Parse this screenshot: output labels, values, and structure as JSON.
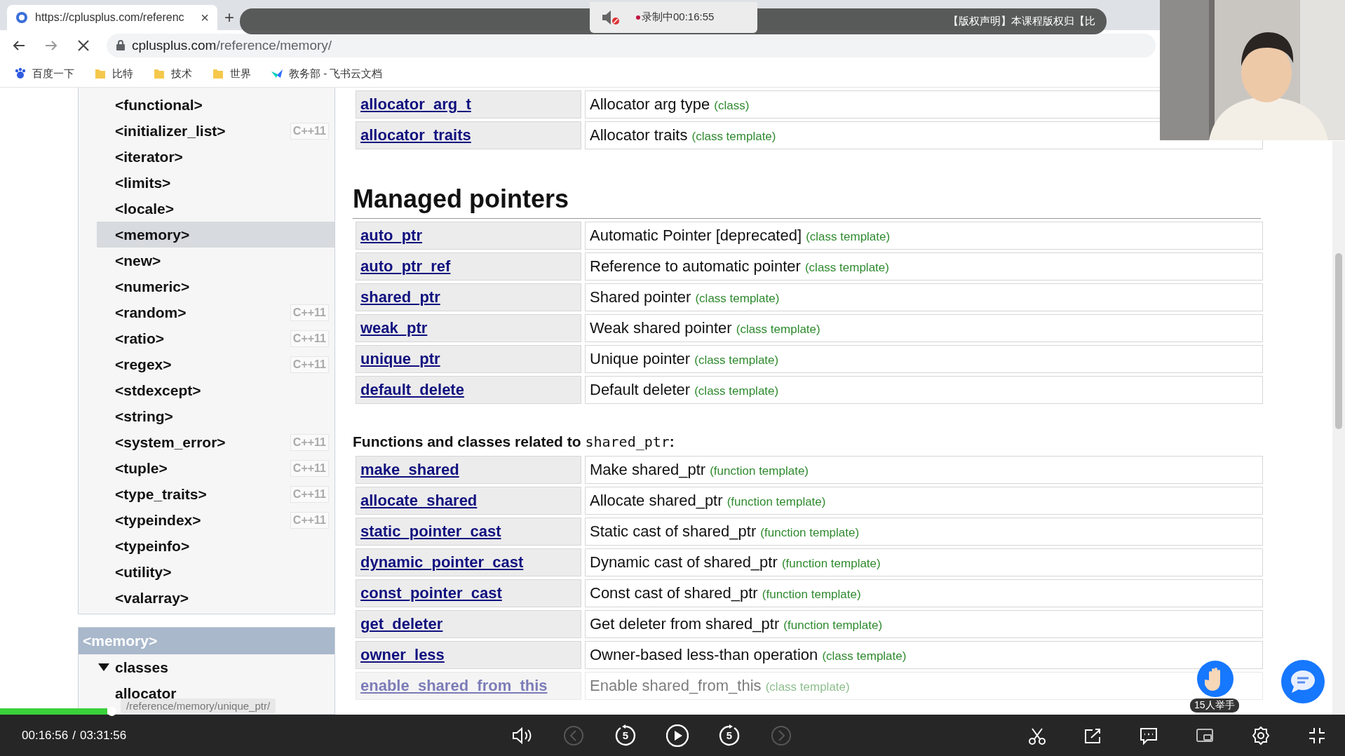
{
  "browser": {
    "tab": {
      "title": "https://cplusplus.com/referenc",
      "close": "×",
      "selected": true
    },
    "new_tab": "+",
    "loading": true,
    "address": {
      "host": "cplusplus.com",
      "path": "/reference/memory/"
    },
    "bookmarks": [
      {
        "label": "百度一下",
        "kind": "site"
      },
      {
        "label": "比特",
        "kind": "folder"
      },
      {
        "label": "技术",
        "kind": "folder"
      },
      {
        "label": "世界",
        "kind": "folder"
      },
      {
        "label": "教务部 - 飞书云文档",
        "kind": "app"
      }
    ]
  },
  "recording_bar": {
    "muted": true,
    "status": "录制中00:16:55",
    "notice": "【版权声明】本课程版权归【比"
  },
  "sidebar": {
    "headers": [
      {
        "label": "<functional>",
        "selected": false
      },
      {
        "label": "<initializer_list>",
        "selected": false,
        "badge": "C++11"
      },
      {
        "label": "<iterator>",
        "selected": false
      },
      {
        "label": "<limits>",
        "selected": false
      },
      {
        "label": "<locale>",
        "selected": false
      },
      {
        "label": "<memory>",
        "selected": true
      },
      {
        "label": "<new>",
        "selected": false
      },
      {
        "label": "<numeric>",
        "selected": false
      },
      {
        "label": "<random>",
        "selected": false,
        "badge": "C++11"
      },
      {
        "label": "<ratio>",
        "selected": false,
        "badge": "C++11"
      },
      {
        "label": "<regex>",
        "selected": false,
        "badge": "C++11"
      },
      {
        "label": "<stdexcept>",
        "selected": false
      },
      {
        "label": "<string>",
        "selected": false
      },
      {
        "label": "<system_error>",
        "selected": false,
        "badge": "C++11"
      },
      {
        "label": "<tuple>",
        "selected": false,
        "badge": "C++11"
      },
      {
        "label": "<type_traits>",
        "selected": false,
        "badge": "C++11"
      },
      {
        "label": "<typeindex>",
        "selected": false,
        "badge": "C++11"
      },
      {
        "label": "<typeinfo>",
        "selected": false
      },
      {
        "label": "<utility>",
        "selected": false
      },
      {
        "label": "<valarray>",
        "selected": false
      }
    ],
    "section": {
      "title": "<memory>",
      "groups": [
        {
          "label": "classes",
          "expanded": true,
          "children": [
            {
              "label": "allocator"
            }
          ]
        }
      ]
    }
  },
  "main": {
    "top_rows": [
      {
        "name": "allocator_arg_t",
        "description": "Allocator arg type",
        "category": "(class)"
      },
      {
        "name": "allocator_traits",
        "description": "Allocator traits",
        "category": "(class template)"
      }
    ],
    "sections": [
      {
        "kind": "heading",
        "title": "Managed pointers",
        "rows": [
          {
            "name": "auto_ptr",
            "description": "Automatic Pointer [deprecated]",
            "category": "(class template)"
          },
          {
            "name": "auto_ptr_ref",
            "description": "Reference to automatic pointer",
            "category": "(class template)"
          },
          {
            "name": "shared_ptr",
            "description": "Shared pointer",
            "category": "(class template)"
          },
          {
            "name": "weak_ptr",
            "description": "Weak shared pointer",
            "category": "(class template)"
          },
          {
            "name": "unique_ptr",
            "description": "Unique pointer",
            "category": "(class template)"
          },
          {
            "name": "default_delete",
            "description": "Default deleter",
            "category": "(class template)"
          }
        ]
      },
      {
        "kind": "subheading",
        "title": "Functions and classes related to ",
        "code": "shared_ptr",
        "suffix": ":",
        "rows": [
          {
            "name": "make_shared",
            "description": "Make shared_ptr",
            "category": "(function template)"
          },
          {
            "name": "allocate_shared",
            "description": "Allocate shared_ptr",
            "category": "(function template)"
          },
          {
            "name": "static_pointer_cast",
            "description": "Static cast of shared_ptr",
            "category": "(function template)"
          },
          {
            "name": "dynamic_pointer_cast",
            "description": "Dynamic cast of shared_ptr",
            "category": "(function template)"
          },
          {
            "name": "const_pointer_cast",
            "description": "Const cast of shared_ptr",
            "category": "(function template)"
          },
          {
            "name": "get_deleter",
            "description": "Get deleter from shared_ptr",
            "category": "(function template)"
          },
          {
            "name": "owner_less",
            "description": "Owner-based less-than operation",
            "category": "(class template)"
          },
          {
            "name": "enable_shared_from_this",
            "description": "Enable shared_from_this",
            "category": "(class template)"
          }
        ]
      }
    ]
  },
  "status_tooltip": "/reference/memory/unique_ptr/",
  "floating": {
    "raise_hand": "15人举手"
  },
  "player": {
    "current": "00:16:56",
    "separator": "/",
    "total": "03:31:56",
    "controls": [
      {
        "kind": "volume",
        "disabled": false
      },
      {
        "kind": "previous",
        "disabled": true
      },
      {
        "kind": "rewind",
        "label": "5",
        "disabled": false
      },
      {
        "kind": "play",
        "disabled": false
      },
      {
        "kind": "forward",
        "label": "5",
        "disabled": false
      },
      {
        "kind": "next",
        "disabled": true
      }
    ],
    "tools": [
      {
        "kind": "clip"
      },
      {
        "kind": "share"
      },
      {
        "kind": "comment"
      },
      {
        "kind": "pip"
      },
      {
        "kind": "settings"
      },
      {
        "kind": "exit_fullscreen"
      }
    ]
  }
}
